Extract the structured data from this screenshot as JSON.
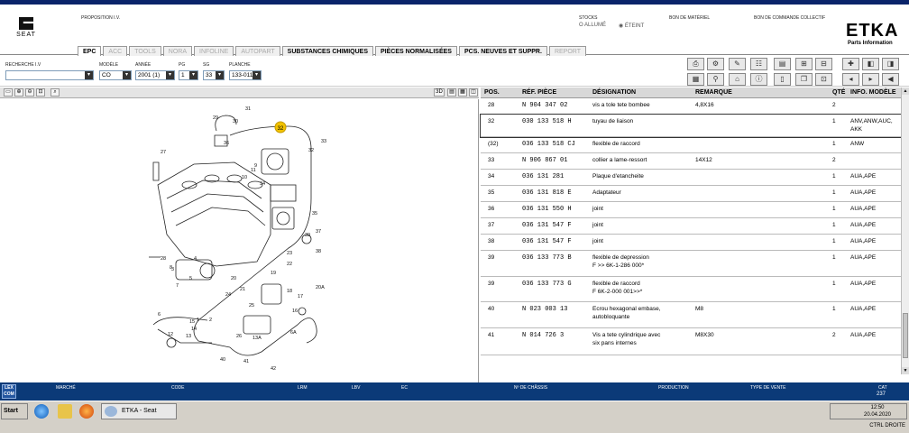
{
  "window": {
    "title": ""
  },
  "brand": {
    "left_logo": "SEAT",
    "etka": "ETKA",
    "etka_sub": "Parts Information"
  },
  "header_labels": {
    "proposition": "PROPOSITION I.V.",
    "stocks": "STOCKS",
    "allume": "O ALLUMÉ",
    "eteint": "◉ ÉTEINT",
    "bon_materiel": "BON DE MATÉRIEL",
    "bon_commande": "BON DE COMMANDE COLLECTIF"
  },
  "tabs": [
    {
      "label": "EPC",
      "state": "active"
    },
    {
      "label": "ACC",
      "state": "disabled"
    },
    {
      "label": "TOOLS",
      "state": "disabled"
    },
    {
      "label": "NORA",
      "state": "disabled"
    },
    {
      "label": "INFOLINE",
      "state": "disabled"
    },
    {
      "label": "AUTOPART",
      "state": "disabled"
    },
    {
      "label": "SUBSTANCES CHIMIQUES",
      "state": "enabled"
    },
    {
      "label": "PIÈCES NORMALISÉES",
      "state": "enabled"
    },
    {
      "label": "PCS. NEUVES ET SUPPR.",
      "state": "enabled"
    },
    {
      "label": "REPORT",
      "state": "disabled"
    }
  ],
  "filters": {
    "recherche_label": "RECHERCHE I.V",
    "recherche_value": "",
    "modele_label": "MODÈLE",
    "modele_value": "CO",
    "annee_label": "ANNÉE",
    "annee_value": "2001 (1)",
    "pg_label": "PG",
    "pg_value": "1",
    "sg_label": "SG",
    "sg_value": "33",
    "planche_label": "PLANCHE",
    "planche_value": "133-011"
  },
  "image_toolbar": {
    "zoom_label": "3D"
  },
  "diagram": {
    "highlight_label": "32",
    "callouts": [
      "29",
      "31",
      "30",
      "36",
      "33",
      "32",
      "34",
      "11",
      "10",
      "9",
      "27",
      "28",
      "8",
      "7",
      "5",
      "4",
      "3",
      "2",
      "1",
      "35",
      "37",
      "39",
      "38",
      "23",
      "22",
      "21",
      "20",
      "19",
      "18",
      "17",
      "16",
      "15",
      "14",
      "13",
      "12",
      "6",
      "24",
      "25",
      "26",
      "40",
      "41",
      "42",
      "20A",
      "13A",
      "6A"
    ]
  },
  "table": {
    "headers": {
      "pos": "POS.",
      "ref": "RÉF. PIÈCE",
      "des": "DÉSIGNATION",
      "rem": "REMARQUE",
      "qte": "QTÉ",
      "info": "INFO. MODÈLE"
    },
    "rows": [
      {
        "pos": "28",
        "ref": "N   904 347 02",
        "des": "vis a tole tete bombee",
        "rem": "4,8X16",
        "qte": "2",
        "info": ""
      },
      {
        "pos": "32",
        "ref": "030 133 518 H",
        "des": "tuyau de liaison",
        "rem": "",
        "qte": "1",
        "info": "ANV,ANW,AUC,",
        "info2": "AKK"
      },
      {
        "pos": "(32)",
        "ref": "036 133 518 CJ",
        "des": "flexible de raccord",
        "rem": "",
        "qte": "1",
        "info": "ANW"
      },
      {
        "pos": "33",
        "ref": "N   906 867 01",
        "des": "collier a lame-ressort",
        "rem": "14X12",
        "qte": "2",
        "info": ""
      },
      {
        "pos": "34",
        "ref": "036 131 281",
        "des": "Plaque d'etancheite",
        "rem": "",
        "qte": "1",
        "info": "AUA,APE"
      },
      {
        "pos": "35",
        "ref": "036 131 818 E",
        "des": "Adaptateur",
        "rem": "",
        "qte": "1",
        "info": "AUA,APE"
      },
      {
        "pos": "36",
        "ref": "036 131 550 H",
        "des": "joint",
        "rem": "",
        "qte": "1",
        "info": "AUA,APE"
      },
      {
        "pos": "37",
        "ref": "036 131 547 F",
        "des": "joint",
        "rem": "",
        "qte": "1",
        "info": "AUA,APE"
      },
      {
        "pos": "38",
        "ref": "036 131 547 F",
        "des": "joint",
        "rem": "",
        "qte": "1",
        "info": "AUA,APE"
      },
      {
        "pos": "39",
        "ref": "036 133 773 B",
        "des": "flexible de depression",
        "des2": "F          >> 6K-1-286 000*",
        "rem": "",
        "qte": "1",
        "info": "AUA,APE"
      },
      {
        "pos": "39",
        "ref": "036 133 773 G",
        "des": "flexible de raccord",
        "des2": "F 6K-2-000 001>>*",
        "rem": "",
        "qte": "1",
        "info": "AUA,APE"
      },
      {
        "pos": "40",
        "ref": "N   023 003 13",
        "des": "Ecrou hexagonal embase,",
        "des2": "autobloquante",
        "rem": "M8",
        "qte": "1",
        "info": "AUA,APE"
      },
      {
        "pos": "41",
        "ref": "N   014 726 3",
        "des": "Vis a tete cylindrique avec",
        "des2": "six pans internes",
        "rem": "M8X30",
        "qte": "2",
        "info": "AUA,APE"
      }
    ]
  },
  "statusbar": {
    "logo": "LEX COM",
    "marche": "MARCHÉ",
    "code": "CODE",
    "lrm": "LRM",
    "lbv": "LBV",
    "ec": "EC",
    "chassis": "Nº DE CHÂSSIS",
    "production": "PRODUCTION",
    "type_vente": "TYPE DE VENTE",
    "cat_label": "CAT",
    "cat_value": "237"
  },
  "taskbar": {
    "start": "Start",
    "task": "ETKA - Seat",
    "time": "12:50",
    "date": "20.04.2020",
    "lang": "CTRL DROITE"
  }
}
